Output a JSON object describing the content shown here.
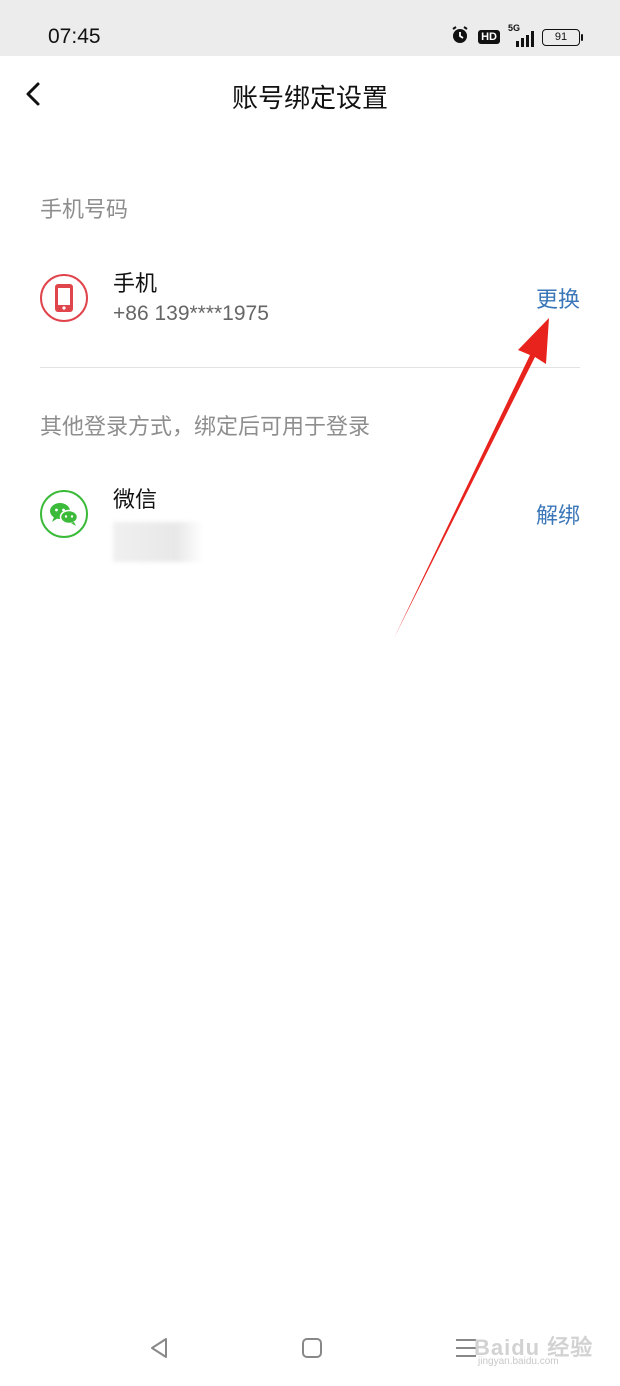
{
  "status_bar": {
    "time": "07:45",
    "hd_label": "HD",
    "network": "5G",
    "battery": "91",
    "icons": [
      "alarm-icon",
      "hd-icon",
      "signal-icon",
      "battery-icon"
    ]
  },
  "header": {
    "title": "账号绑定设置",
    "back_icon": "back-chevron-icon"
  },
  "phone_section": {
    "title": "手机号码",
    "item": {
      "name": "手机",
      "value": "+86 139****1975",
      "action": "更换",
      "icon": "phone-icon",
      "icon_color": "#e0454c"
    }
  },
  "other_section": {
    "title": "其他登录方式，绑定后可用于登录",
    "item": {
      "name": "微信",
      "action": "解绑",
      "icon": "wechat-icon",
      "icon_color": "#3cba3a"
    }
  },
  "nav_bar": {
    "buttons": [
      "back-triangle-icon",
      "home-square-icon",
      "menu-lines-icon"
    ]
  },
  "watermark": {
    "brand": "Baidu 经验",
    "url": "jingyan.baidu.com"
  },
  "colors": {
    "accent_link": "#3b77b8",
    "annotation_arrow": "#e8231d",
    "section_title": "#8e8e8e"
  }
}
